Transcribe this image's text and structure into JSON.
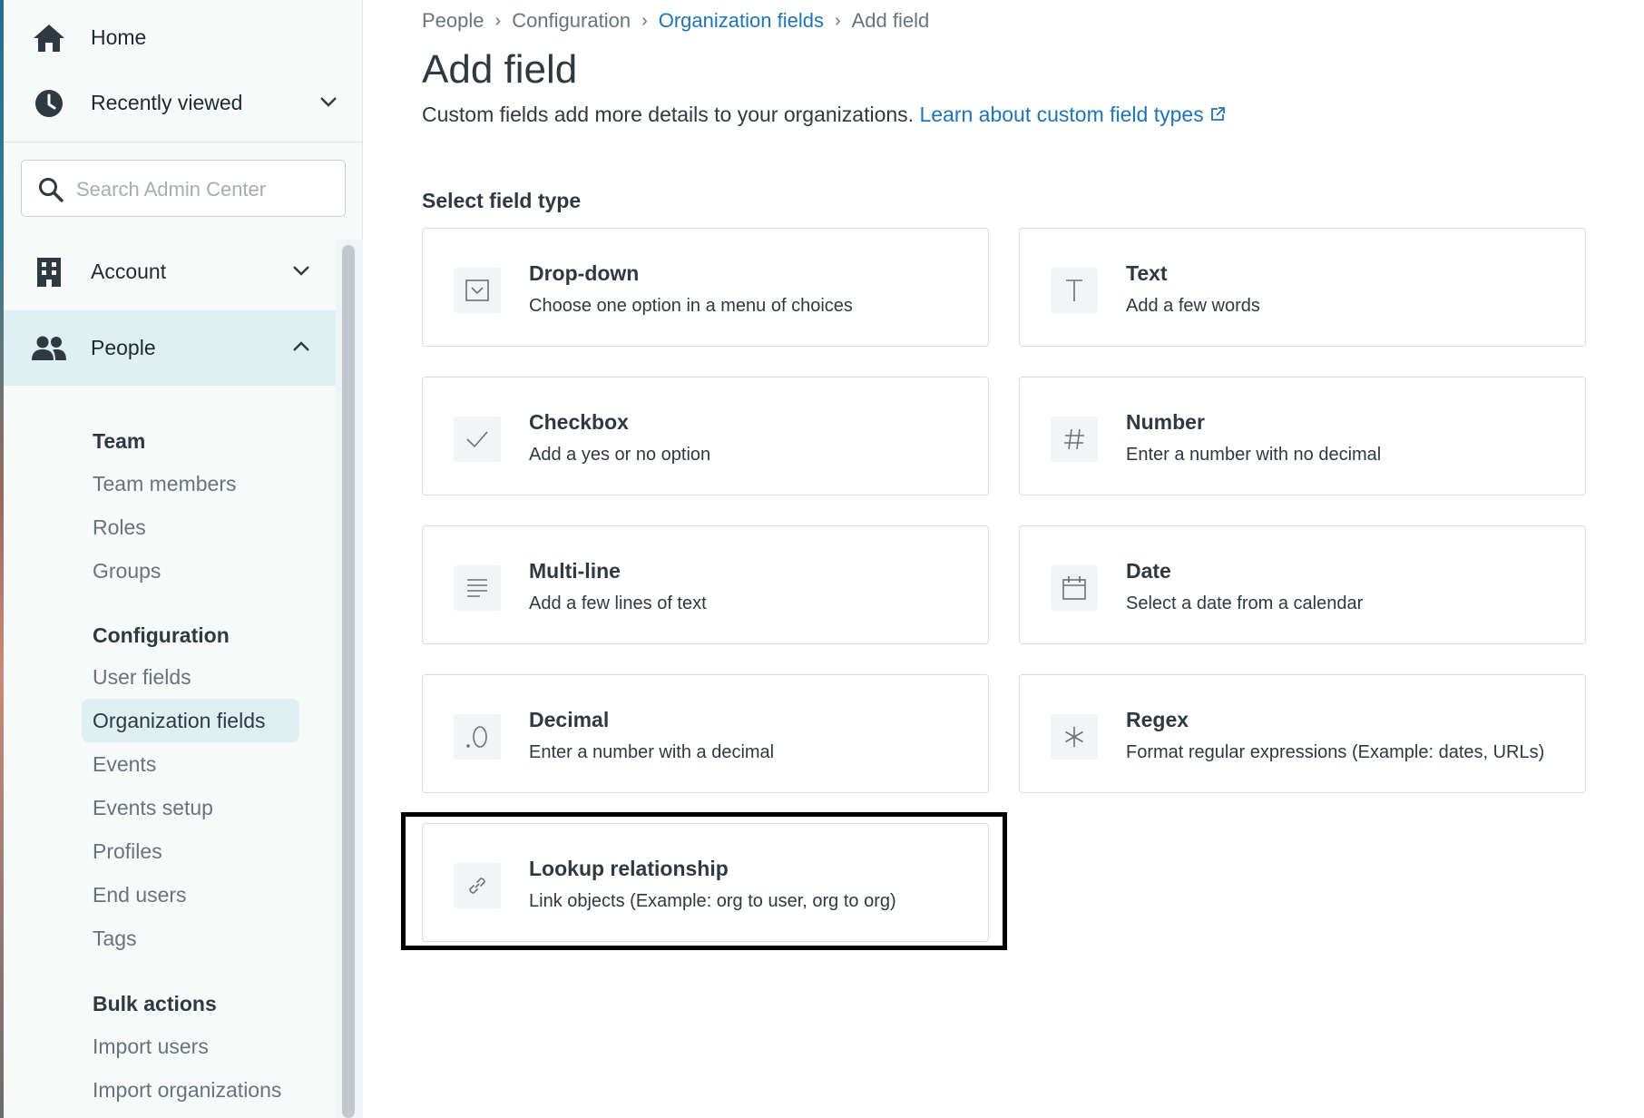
{
  "sidebar": {
    "home_label": "Home",
    "recent_label": "Recently viewed",
    "search_placeholder": "Search Admin Center",
    "account_label": "Account",
    "people_label": "People",
    "team_heading": "Team",
    "team_items": [
      "Team members",
      "Roles",
      "Groups"
    ],
    "config_heading": "Configuration",
    "config_items": [
      "User fields",
      "Organization fields",
      "Events",
      "Events setup",
      "Profiles",
      "End users",
      "Tags"
    ],
    "bulk_heading": "Bulk actions",
    "bulk_items": [
      "Import users",
      "Import organizations"
    ]
  },
  "breadcrumb": [
    "People",
    "Configuration",
    "Organization fields",
    "Add field"
  ],
  "page": {
    "title": "Add field",
    "description": "Custom fields add more details to your organizations.",
    "learn_link": "Learn about custom field types",
    "section_label": "Select field type"
  },
  "field_types": [
    {
      "title": "Drop-down",
      "desc": "Choose one option in a menu of choices",
      "icon": "dropdown-icon"
    },
    {
      "title": "Text",
      "desc": "Add a few words",
      "icon": "text-icon"
    },
    {
      "title": "Checkbox",
      "desc": "Add a yes or no option",
      "icon": "checkmark-icon"
    },
    {
      "title": "Number",
      "desc": "Enter a number with no decimal",
      "icon": "hash-icon"
    },
    {
      "title": "Multi-line",
      "desc": "Add a few lines of text",
      "icon": "lines-icon"
    },
    {
      "title": "Date",
      "desc": "Select a date from a calendar",
      "icon": "calendar-icon"
    },
    {
      "title": "Decimal",
      "desc": "Enter a number with a decimal",
      "icon": "decimal-icon"
    },
    {
      "title": "Regex",
      "desc": "Format regular expressions (Example: dates, URLs)",
      "icon": "asterisk-icon"
    },
    {
      "title": "Lookup relationship",
      "desc": "Link objects (Example: org to user, org to org)",
      "icon": "link-icon"
    }
  ],
  "colors": {
    "link": "#1f73b7",
    "active_bg": "#dff0f2",
    "text": "#2f3941",
    "muted": "#68737d"
  }
}
